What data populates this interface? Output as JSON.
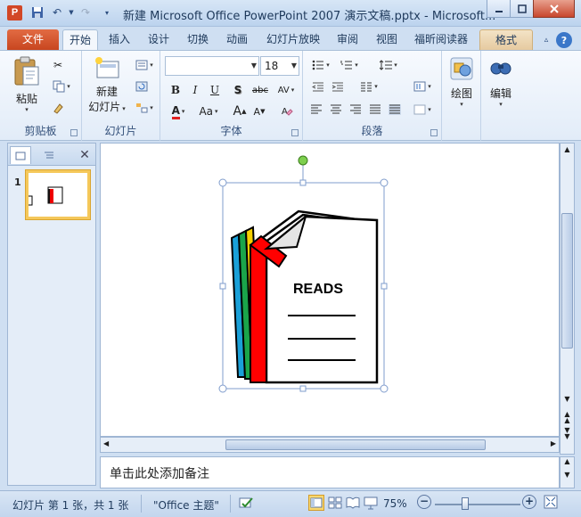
{
  "window": {
    "title": "新建 Microsoft Office PowerPoint 2007 演示文稿.pptx - Microsoft..."
  },
  "tabs": [
    "文件",
    "开始",
    "插入",
    "设计",
    "切换",
    "动画",
    "幻灯片放映",
    "审阅",
    "视图",
    "福昕阅读器",
    "格式"
  ],
  "ribbon": {
    "clipboard": {
      "label": "剪贴板",
      "paste": "粘贴"
    },
    "slides": {
      "label": "幻灯片",
      "new_slide_line1": "新建",
      "new_slide_line2": "幻灯片"
    },
    "font": {
      "label": "字体",
      "font_name": "",
      "font_size": "18",
      "bold": "B",
      "italic": "I",
      "underline": "U",
      "shadow": "S",
      "strike": "abc",
      "spacing": "AV",
      "color": "A",
      "case": "Aa"
    },
    "paragraph": {
      "label": "段落"
    },
    "drawing": {
      "label": "绘图"
    },
    "editing": {
      "label": "编辑"
    }
  },
  "left_pane": {
    "slide_number": "1"
  },
  "slide": {
    "clipart_text": "READS"
  },
  "notes": {
    "placeholder": "单击此处添加备注"
  },
  "status": {
    "slide_info": "幻灯片 第 1 张，共 1 张",
    "theme": "\"Office 主题\"",
    "zoom": "75%"
  }
}
